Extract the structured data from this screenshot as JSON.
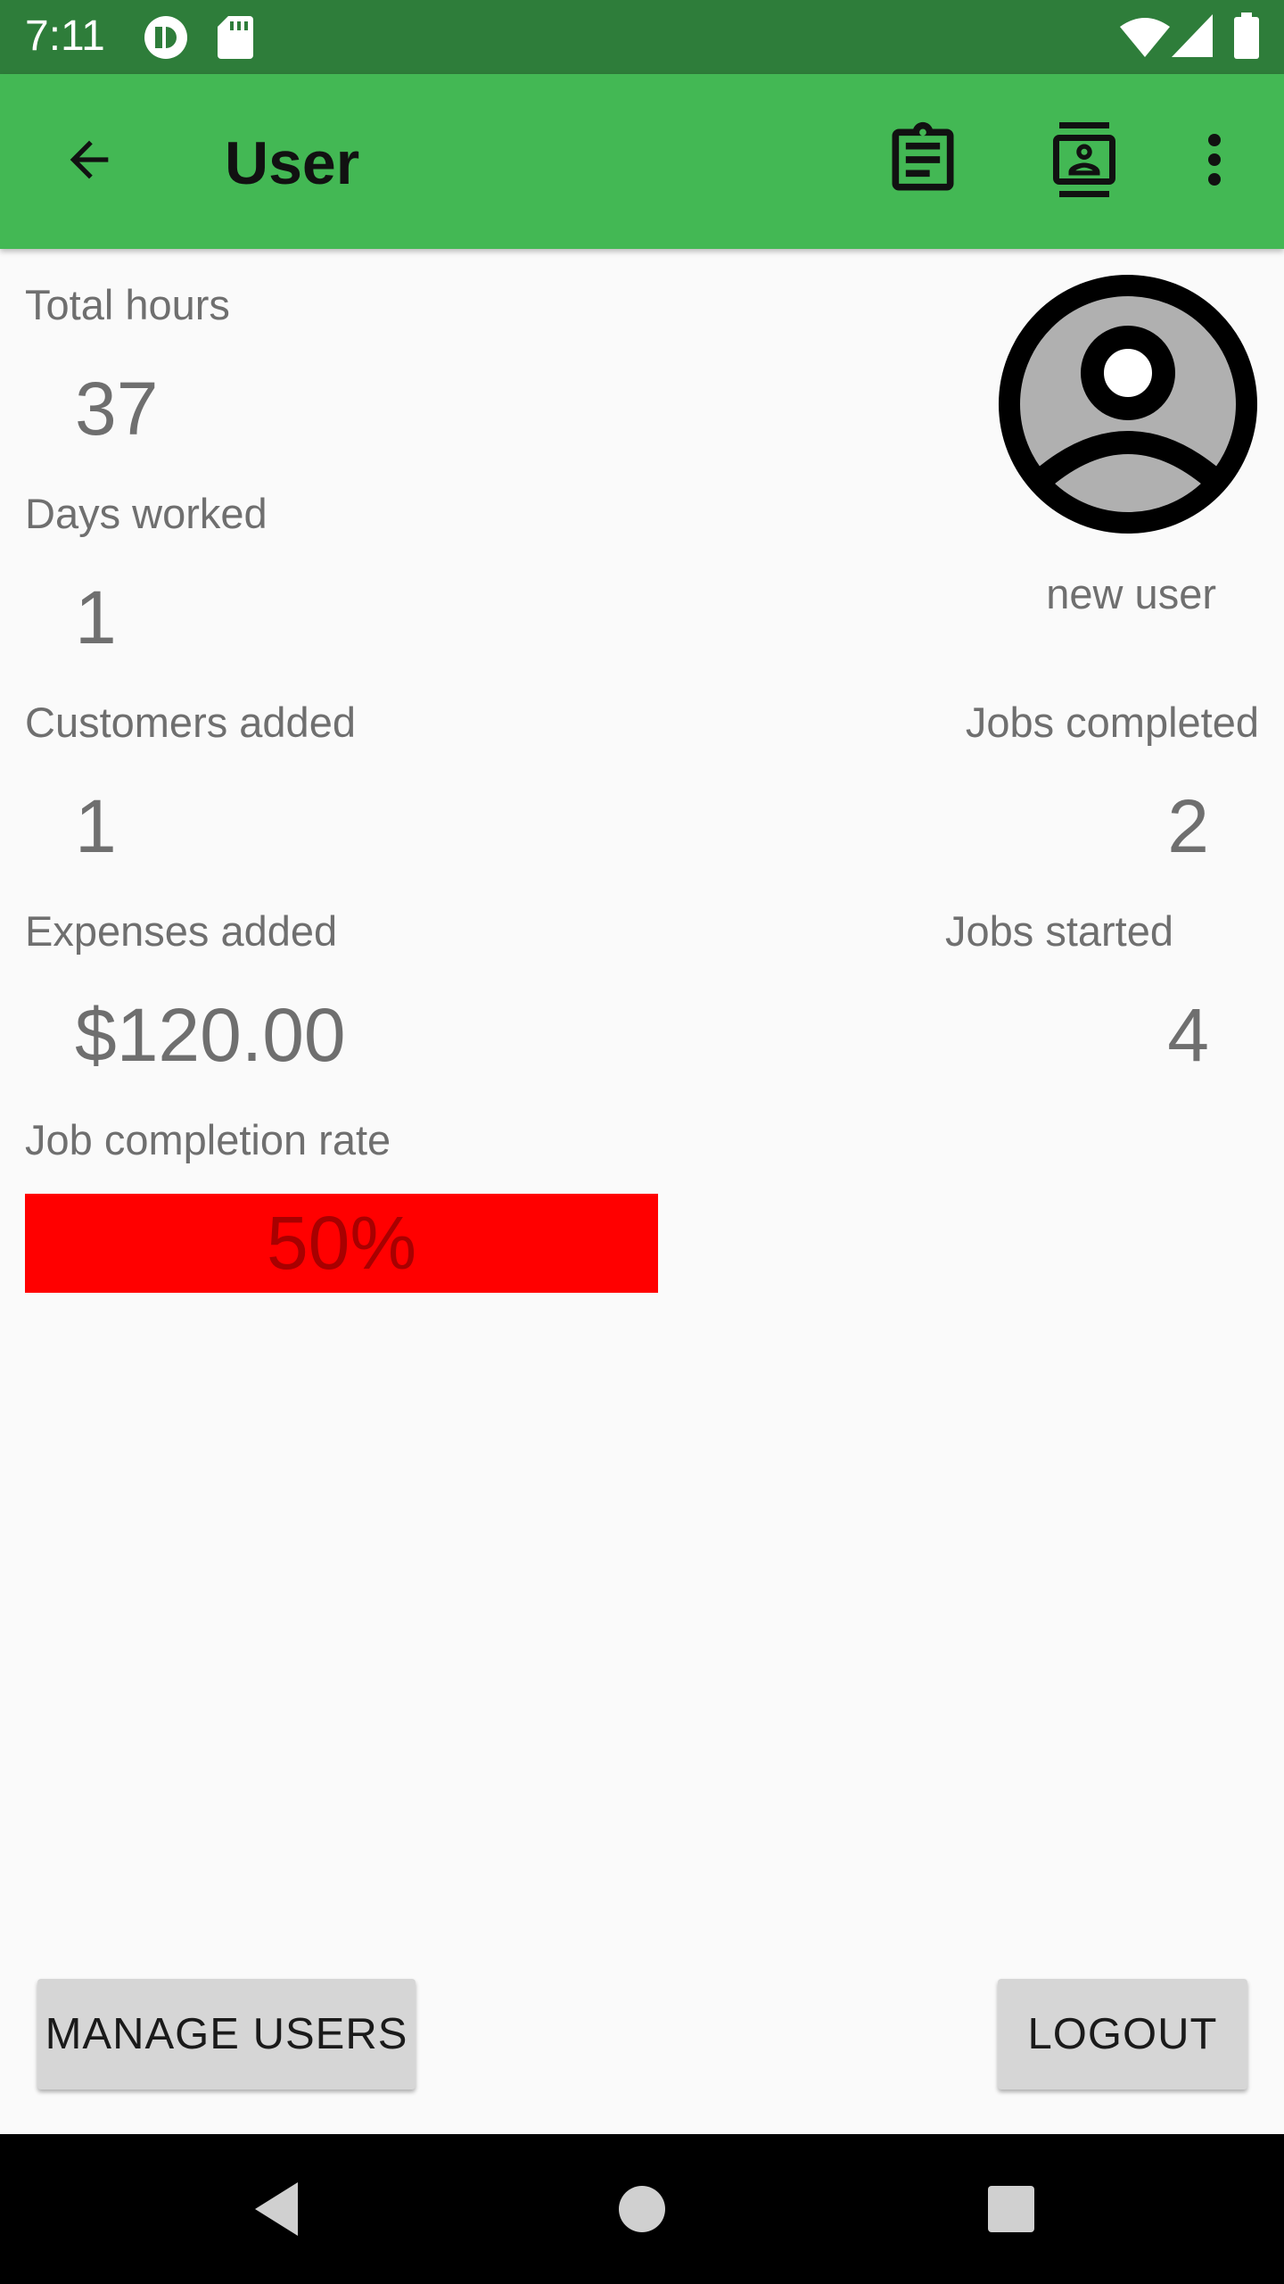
{
  "status_bar": {
    "time": "7:11",
    "icons": [
      "notification-app-icon",
      "sd-card-icon",
      "wifi-icon",
      "cell-signal-icon",
      "battery-icon"
    ],
    "background": "#2e7d3a"
  },
  "app_bar": {
    "title": "User",
    "background": "#43b854",
    "actions": [
      "back-arrow-icon",
      "clipboard-icon",
      "contact-card-icon",
      "overflow-menu-icon"
    ]
  },
  "stats": {
    "total_hours": {
      "label": "Total hours",
      "value": "37"
    },
    "days_worked": {
      "label": "Days worked",
      "value": "1"
    },
    "customers_added": {
      "label": "Customers added",
      "value": "1"
    },
    "expenses_added": {
      "label": "Expenses added",
      "value": "$120.00"
    },
    "jobs_completed": {
      "label": "Jobs completed",
      "value": "2"
    },
    "jobs_started": {
      "label": "Jobs started",
      "value": "4"
    }
  },
  "profile": {
    "username": "new user",
    "avatar_icon": "account-circle-icon"
  },
  "completion": {
    "label": "Job completion rate",
    "text": "50%",
    "fraction": 0.5,
    "fill_color": "#ff0000"
  },
  "buttons": {
    "manage_users": "MANAGE USERS",
    "logout": "LOGOUT"
  },
  "nav_bar": {
    "icons": [
      "back-triangle-icon",
      "home-circle-icon",
      "recents-square-icon"
    ]
  }
}
